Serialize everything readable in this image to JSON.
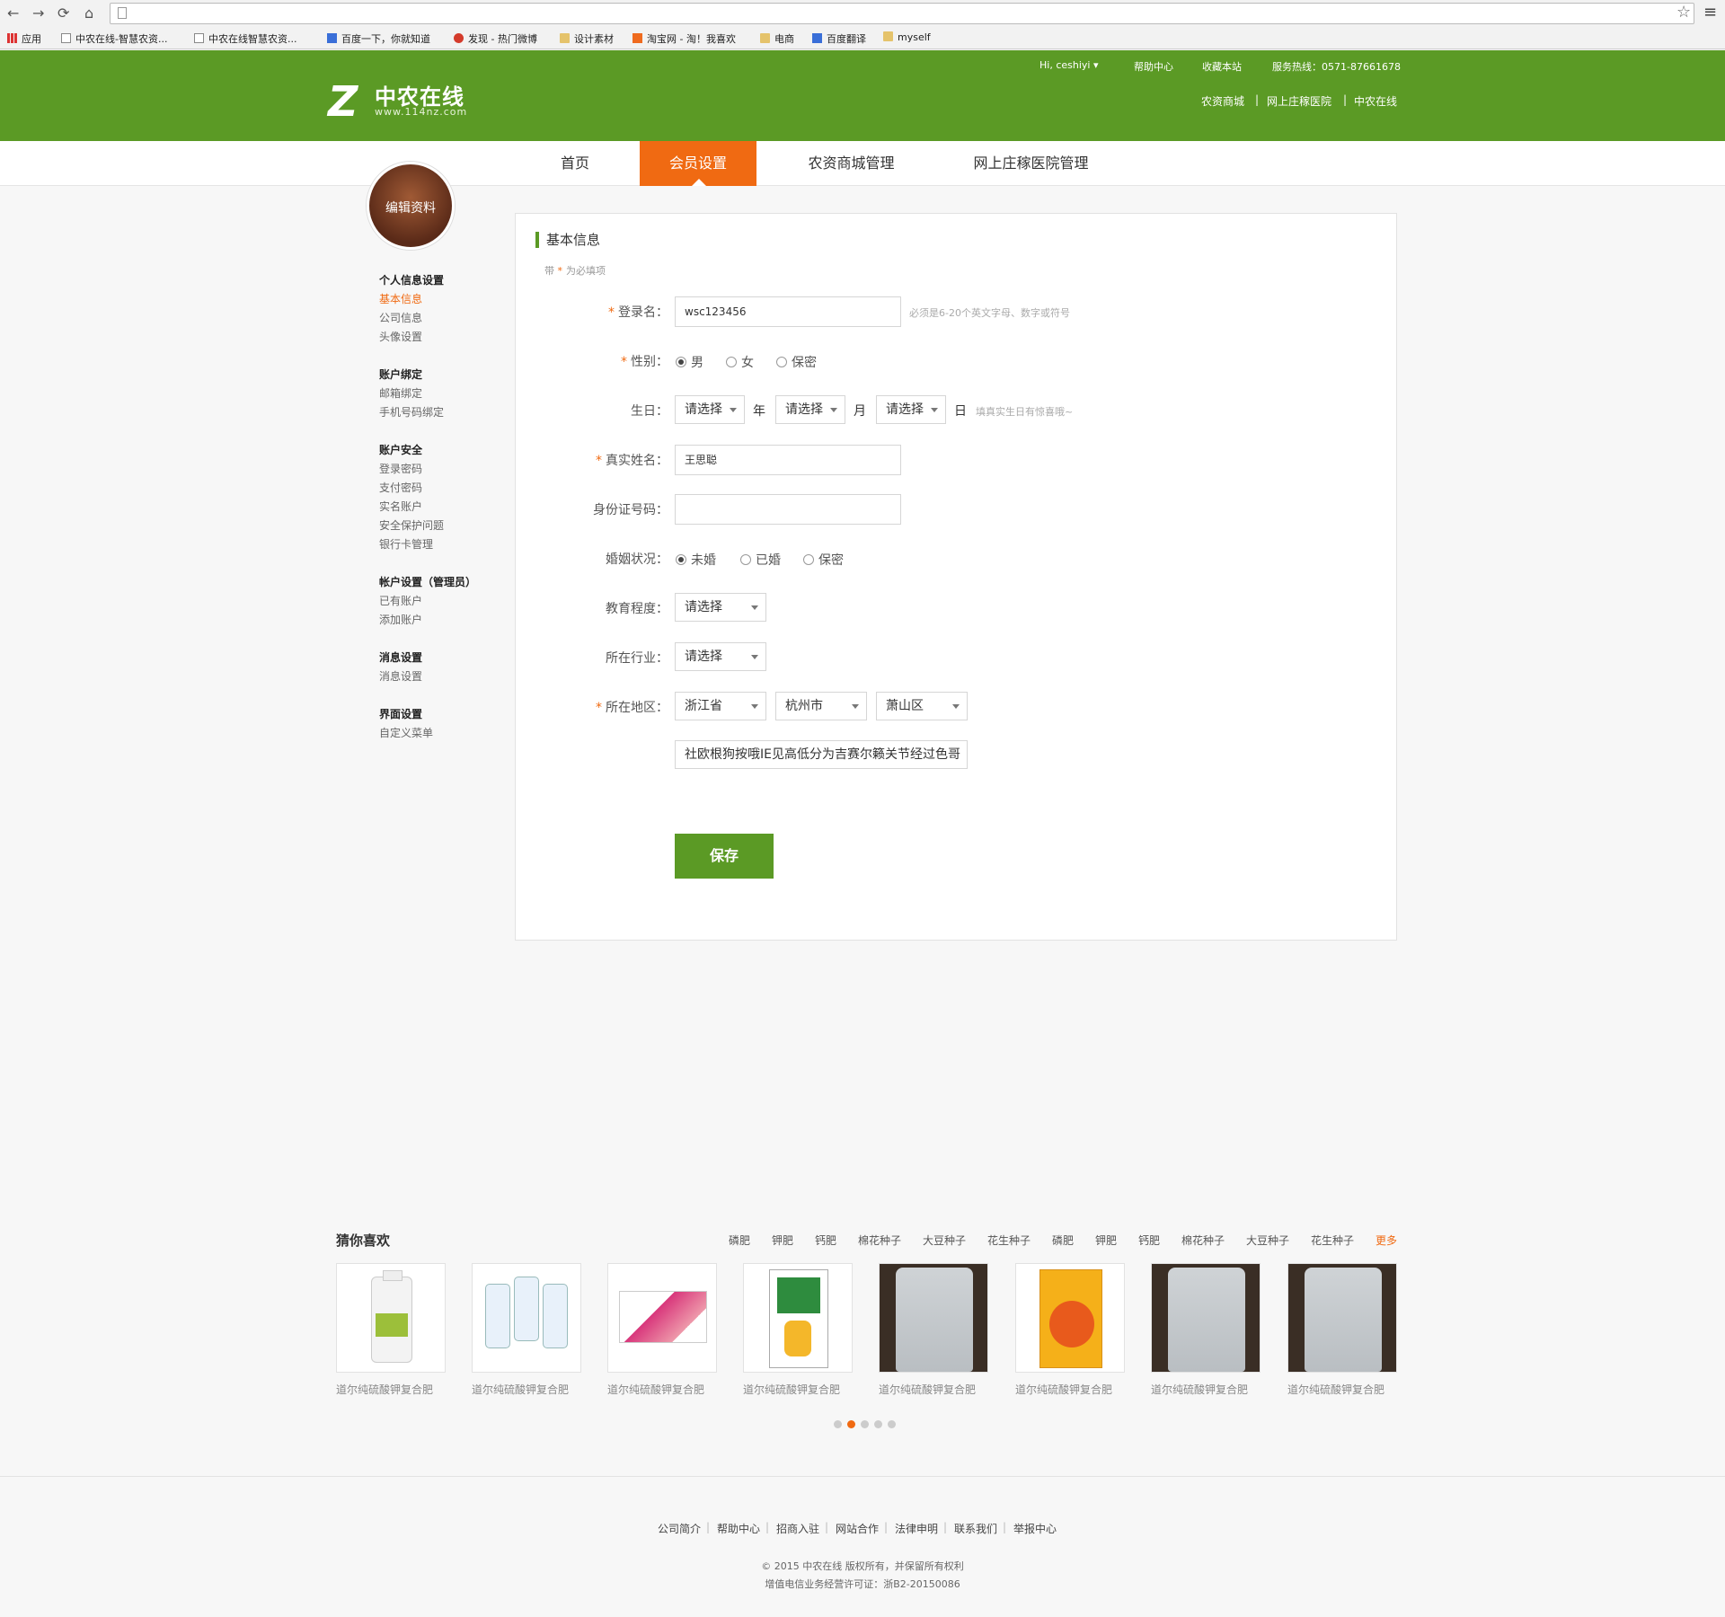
{
  "browser": {
    "bookmarks": [
      "应用",
      "中农在线-智慧农资...",
      "中农在线智慧农资...",
      "百度一下，你就知道",
      "发现 - 热门微博",
      "设计素材",
      "淘宝网 - 淘！我喜欢",
      "电商",
      "百度翻译",
      "myself"
    ]
  },
  "header": {
    "logo_title": "中农在线",
    "logo_url": "www.114nz.com",
    "greeting": "Hi, ceshiyi",
    "help": "帮助中心",
    "favorite": "收藏本站",
    "hotline": "服务热线：0571-87661678",
    "links": [
      "农资商城",
      "网上庄稼医院",
      "中农在线"
    ]
  },
  "nav": {
    "items": [
      "首页",
      "会员设置",
      "农资商城管理",
      "网上庄稼医院管理"
    ],
    "active": "会员设置"
  },
  "sidebar": {
    "avatar_label": "编辑资料",
    "groups": [
      {
        "title": "个人信息设置",
        "items": [
          "基本信息",
          "公司信息",
          "头像设置"
        ]
      },
      {
        "title": "账户绑定",
        "items": [
          "邮箱绑定",
          "手机号码绑定"
        ]
      },
      {
        "title": "账户安全",
        "items": [
          "登录密码",
          "支付密码",
          "实名账户",
          "安全保护问题",
          "银行卡管理"
        ]
      },
      {
        "title": "帐户设置（管理员）",
        "items": [
          "已有账户",
          "添加账户"
        ]
      },
      {
        "title": "消息设置",
        "items": [
          "消息设置"
        ]
      },
      {
        "title": "界面设置",
        "items": [
          "自定义菜单"
        ]
      }
    ]
  },
  "form": {
    "title": "基本信息",
    "note_prefix": "带",
    "note_star": "*",
    "note_suffix": "为必填项",
    "star": "*",
    "username_label": "登录名：",
    "username_value": "wsc123456",
    "username_hint": "必须是6-20个英文字母、数字或符号",
    "gender_label": "性别：",
    "gender_options": [
      "男",
      "女",
      "保密"
    ],
    "gender_selected": "男",
    "birthday_label": "生日：",
    "birthday_year": "请选择",
    "birthday_month": "请选择",
    "birthday_day": "请选择",
    "unit_year": "年",
    "unit_month": "月",
    "unit_day": "日",
    "birthday_hint": "填真实生日有惊喜哦~",
    "realname_label": "真实姓名：",
    "realname_value": "王思聪",
    "idcard_label": "身份证号码：",
    "idcard_value": "",
    "marital_label": "婚姻状况：",
    "marital_options": [
      "未婚",
      "已婚",
      "保密"
    ],
    "marital_selected": "未婚",
    "education_label": "教育程度：",
    "education_value": "请选择",
    "industry_label": "所在行业：",
    "industry_value": "请选择",
    "region_label": "所在地区：",
    "province": "浙江省",
    "city": "杭州市",
    "district": "萧山区",
    "address": "社欧根狗按哦IE见高低分为吉赛尔籁关节经过色哥",
    "save": "保存"
  },
  "recommend": {
    "title": "猜你喜欢",
    "tags": [
      "磷肥",
      "钾肥",
      "钙肥",
      "棉花种子",
      "大豆种子",
      "花生种子",
      "磷肥",
      "钾肥",
      "钙肥",
      "棉花种子",
      "大豆种子",
      "花生种子"
    ],
    "more": "更多",
    "products": [
      "道尔纯硫酸钾复合肥",
      "道尔纯硫酸钾复合肥",
      "道尔纯硫酸钾复合肥",
      "道尔纯硫酸钾复合肥",
      "道尔纯硫酸钾复合肥",
      "道尔纯硫酸钾复合肥",
      "道尔纯硫酸钾复合肥",
      "道尔纯硫酸钾复合肥"
    ],
    "page_count": 5,
    "page_active": 2
  },
  "footer": {
    "links": [
      "公司简介",
      "帮助中心",
      "招商入驻",
      "网站合作",
      "法律申明",
      "联系我们",
      "举报中心"
    ],
    "copyright": "© 2015  中农在线 版权所有，并保留所有权利",
    "license": "增值电信业务经营许可证：浙B2-20150086"
  },
  "colors": {
    "brand_green": "#5b9a25",
    "accent_orange": "#f06a12"
  }
}
